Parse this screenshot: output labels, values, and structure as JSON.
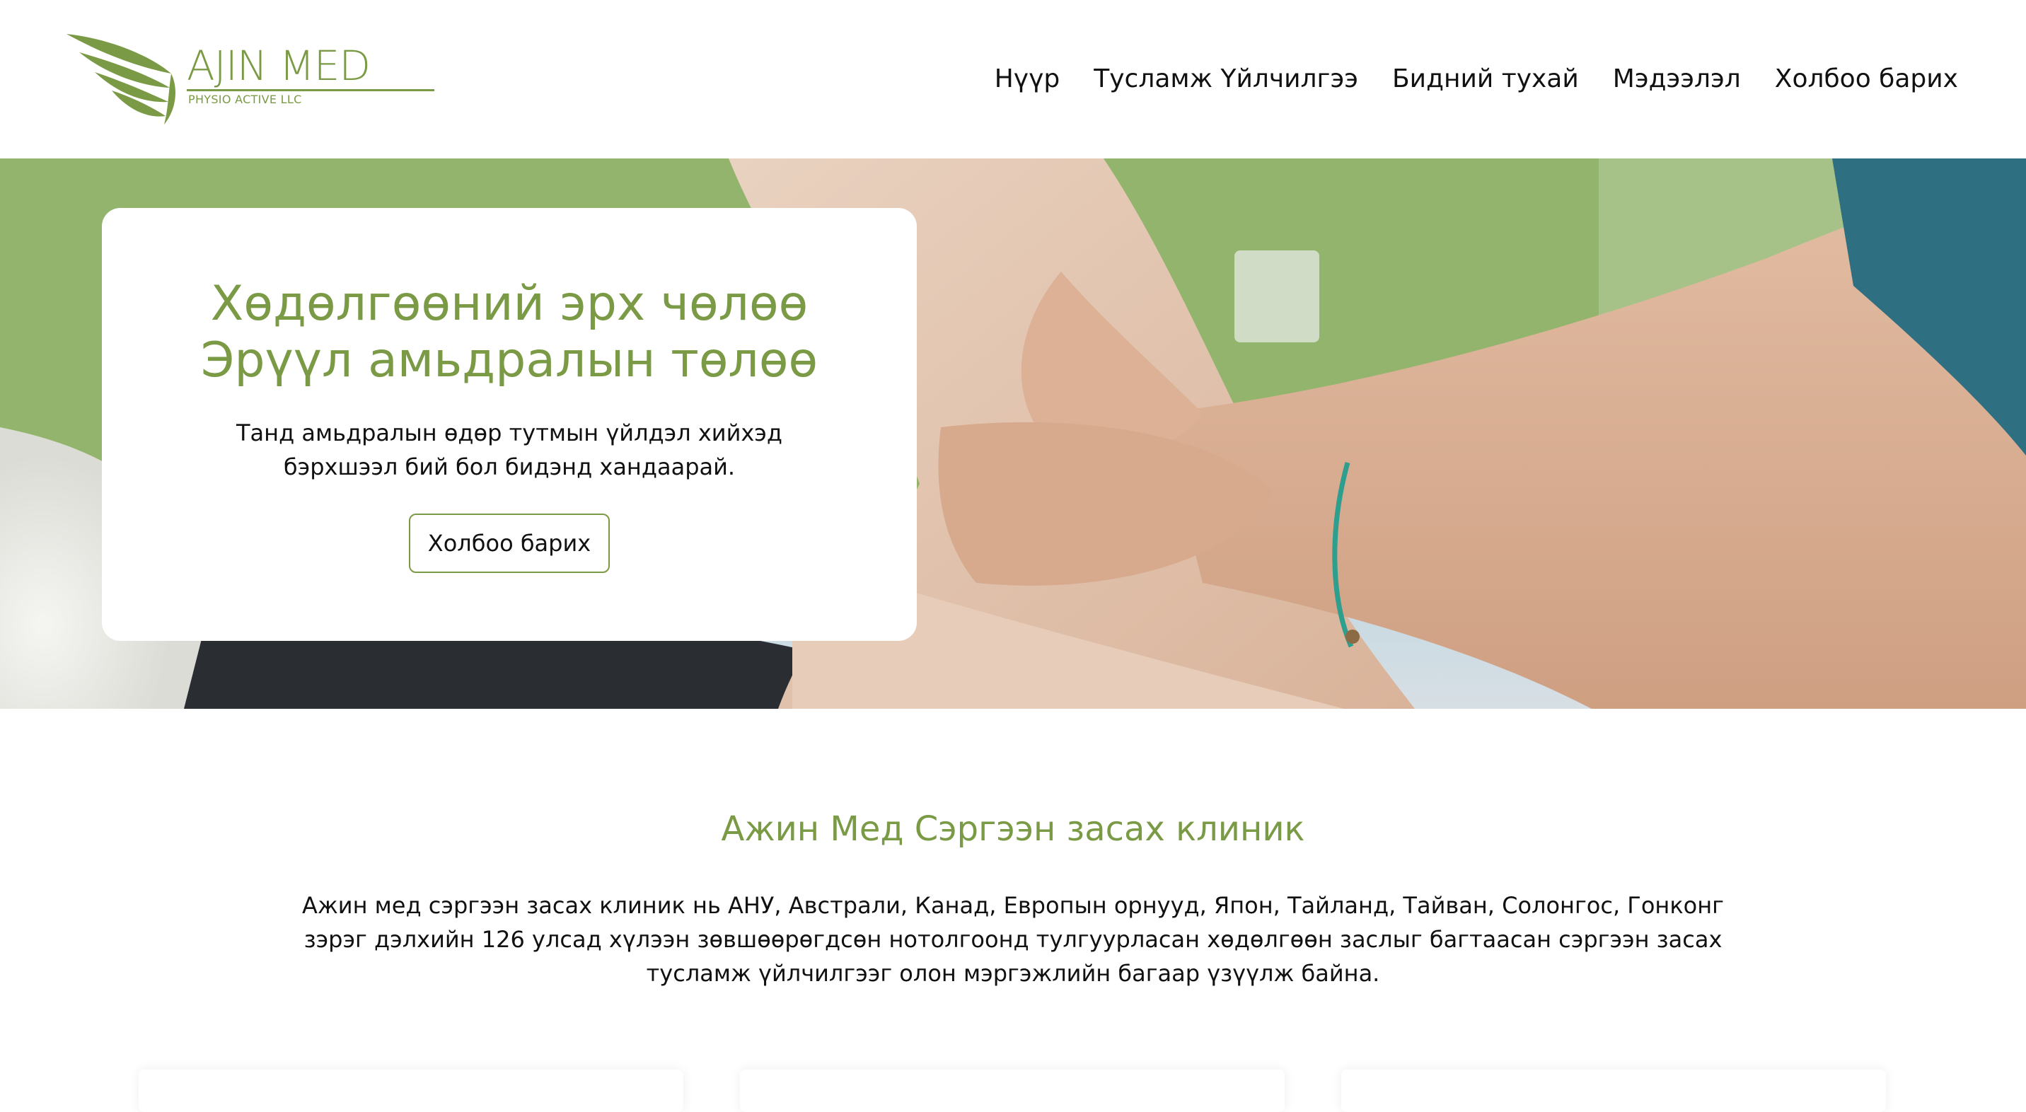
{
  "brand": {
    "name": "AJIN MED",
    "subtitle": "PHYSIO ACTIVE LLC",
    "accent_color": "#7a9a45"
  },
  "nav": {
    "items": [
      {
        "label": "Нүүр"
      },
      {
        "label": "Тусламж Үйлчилгээ"
      },
      {
        "label": "Бидний тухай"
      },
      {
        "label": "Мэдээлэл"
      },
      {
        "label": "Холбоо барих"
      }
    ]
  },
  "hero": {
    "title_line1": "Хөдөлгөөний эрх чөлөө",
    "title_line2": "Эрүүл амьдралын төлөө",
    "text": "Танд амьдралын өдөр тутмын үйлдэл хийхэд бэрхшээл бий бол бидэнд хандаарай.",
    "button_label": "Холбоо барих",
    "image_icon": "knee-physiotherapy-photo"
  },
  "about": {
    "title": "Ажин Мед Сэргээн засах клиник",
    "text": "Ажин мед сэргээн засах клиник нь АНУ, Австрали, Канад, Европын орнууд, Япон, Тайланд, Тайван, Солонгос, Гонконг зэрэг дэлхийн 126 улсад хүлээн зөвшөөрөгдсөн нотолгоонд тулгуурласан хөдөлгөөн заслыг багтаасан сэргээн засах тусламж үйлчилгээг олон мэргэжлийн багаар үзүүлж байна."
  }
}
